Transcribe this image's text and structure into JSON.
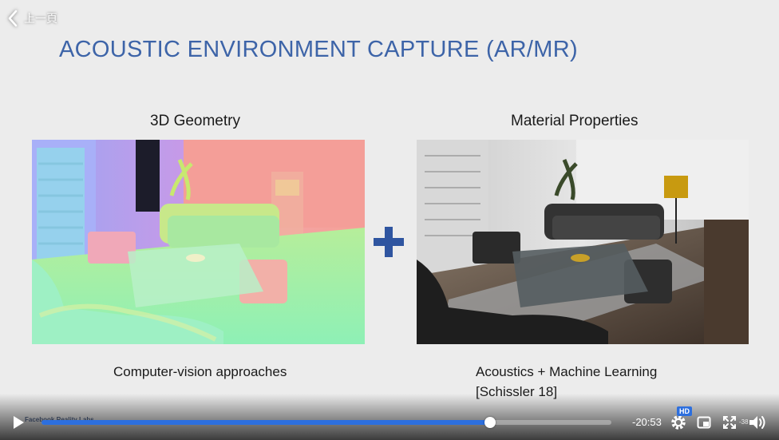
{
  "nav": {
    "back_label": "上一頁"
  },
  "slide": {
    "title": "ACOUSTIC ENVIRONMENT CAPTURE (AR/MR)",
    "left_heading": "3D Geometry",
    "right_heading": "Material Properties",
    "left_caption": "Computer-vision approaches",
    "right_caption_line1": "Acoustics + Machine Learning",
    "right_caption_line2": "[Schissler 18]",
    "watermark": "Facebook Reality Labs"
  },
  "player": {
    "time_remaining": "-20:53",
    "progress_fraction": 0.787,
    "hd_label": "HD",
    "volume_label": "-38",
    "accent_color": "#2d6fde"
  },
  "colors": {
    "title": "#3d64a8",
    "plus": "#2f55a0"
  },
  "icons": [
    "chevron-left-icon",
    "plus-icon",
    "play-icon",
    "settings-icon",
    "pip-icon",
    "fullscreen-icon",
    "volume-icon"
  ]
}
